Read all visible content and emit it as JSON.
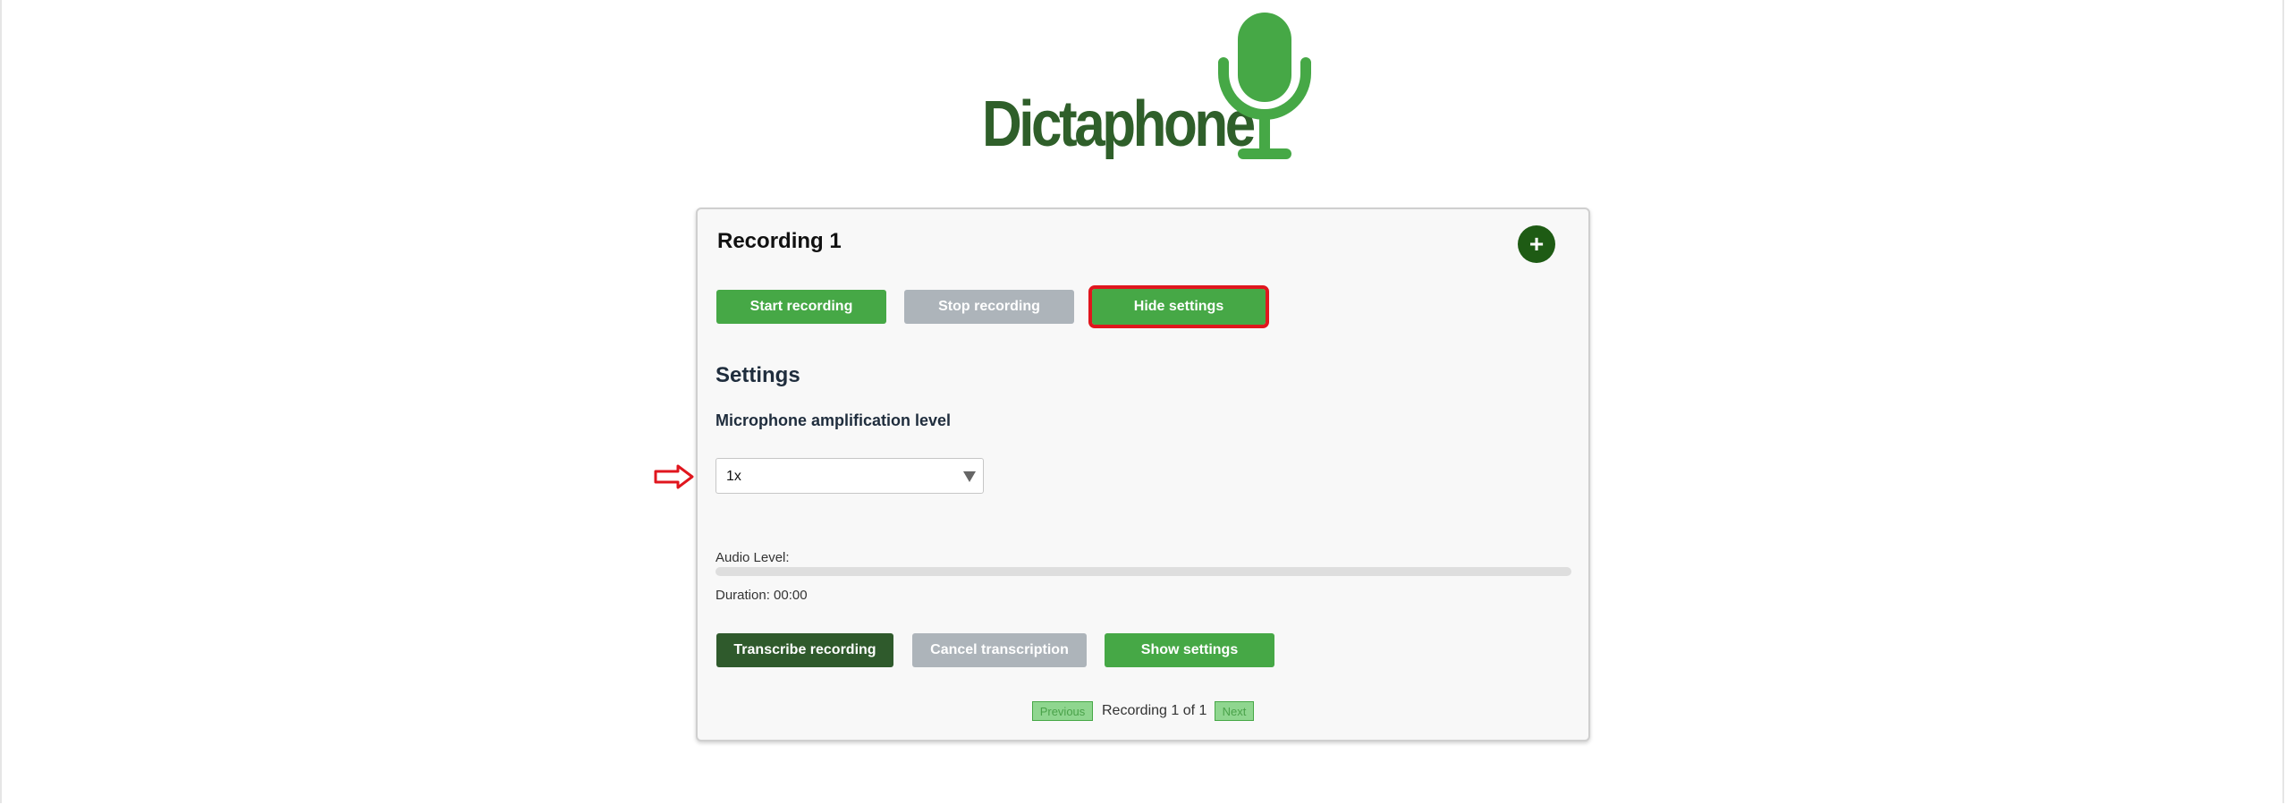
{
  "app": {
    "logo_text": "Dictaphone"
  },
  "recording": {
    "title": "Recording 1",
    "add_label": "+",
    "start_label": "Start recording",
    "stop_label": "Stop recording",
    "hide_settings_label": "Hide settings"
  },
  "settings": {
    "heading": "Settings",
    "amp_label": "Microphone amplification level",
    "amp_value": "1x"
  },
  "audio": {
    "level_label": "Audio Level:",
    "level_fraction": 0,
    "duration_text": "Duration: 00:00"
  },
  "actions": {
    "transcribe_label": "Transcribe recording",
    "cancel_label": "Cancel transcription",
    "show_settings_label": "Show settings"
  },
  "pagination": {
    "previous_label": "Previous",
    "status_text": "Recording 1 of 1",
    "next_label": "Next"
  },
  "colors": {
    "primary_green": "#46a846",
    "dark_green": "#2f5a2c",
    "disabled_gray": "#adb4ba",
    "highlight_red": "#e0161e",
    "logo_dark": "#2f5f2a"
  },
  "icons": {
    "logo": "microphone-icon",
    "add": "plus-icon",
    "select_caret": "caret-down-icon",
    "annotation": "arrow-right-icon"
  }
}
